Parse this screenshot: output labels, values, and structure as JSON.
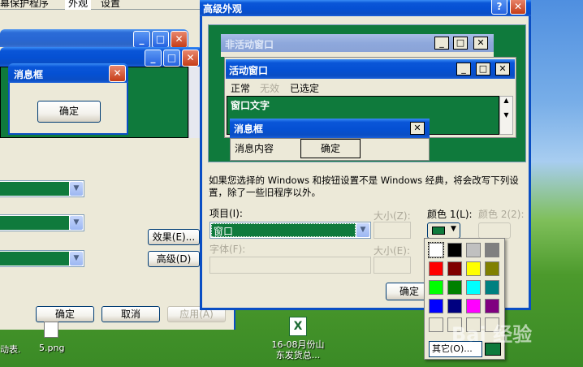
{
  "back_window": {
    "tabs": [
      "幕保护程序",
      "外观",
      "设置"
    ],
    "effects_button": "效果(E)...",
    "advanced_button": "高级(D)",
    "ok_button": "确定",
    "cancel_button": "取消",
    "apply_button": "应用(A)"
  },
  "preview_left": {
    "msgbox_title": "消息框",
    "msgbox_ok": "确定"
  },
  "dialog": {
    "title": "高级外观",
    "help_btn": "?",
    "close_btn": "✕",
    "preview": {
      "inactive_title": "非活动窗口",
      "active_title": "活动窗口",
      "menu": [
        "正常",
        "无效",
        "已选定"
      ],
      "window_text": "窗口文字",
      "msgbox_title": "消息框",
      "msgbox_text": "消息内容",
      "msgbox_ok": "确定"
    },
    "info_text": "如果您选择的 Windows 和按钮设置不是 Windows 经典，将会改写下列设置，除了一些旧程序以外。",
    "item_label": "项目(I):",
    "item_value": "窗口",
    "size_label": "大小(Z):",
    "color1_label": "颜色 1(L):",
    "color2_label": "颜色 2(2):",
    "font_label": "字体(F):",
    "size2_label": "大小(E):",
    "ok_button": "确定"
  },
  "palette": {
    "colors": [
      "#ffffff",
      "#000000",
      "#c0c0c0",
      "#808080",
      "#ff0000",
      "#800000",
      "#ffff00",
      "#808000",
      "#00ff00",
      "#008000",
      "#00ffff",
      "#008080",
      "#0000ff",
      "#000080",
      "#ff00ff",
      "#800080",
      "#ece9d8",
      "#ece9d8",
      "#ece9d8",
      "#ece9d8"
    ],
    "other_button": "其它(O)...",
    "current_color": "#0f7a3c"
  },
  "desktop": {
    "icons": [
      {
        "label": "5.png",
        "name": "png"
      },
      {
        "label": "16-08月份山\n东发货总...",
        "name": "excel"
      }
    ],
    "partial_label": "动表."
  },
  "watermark": "Bai 经验"
}
